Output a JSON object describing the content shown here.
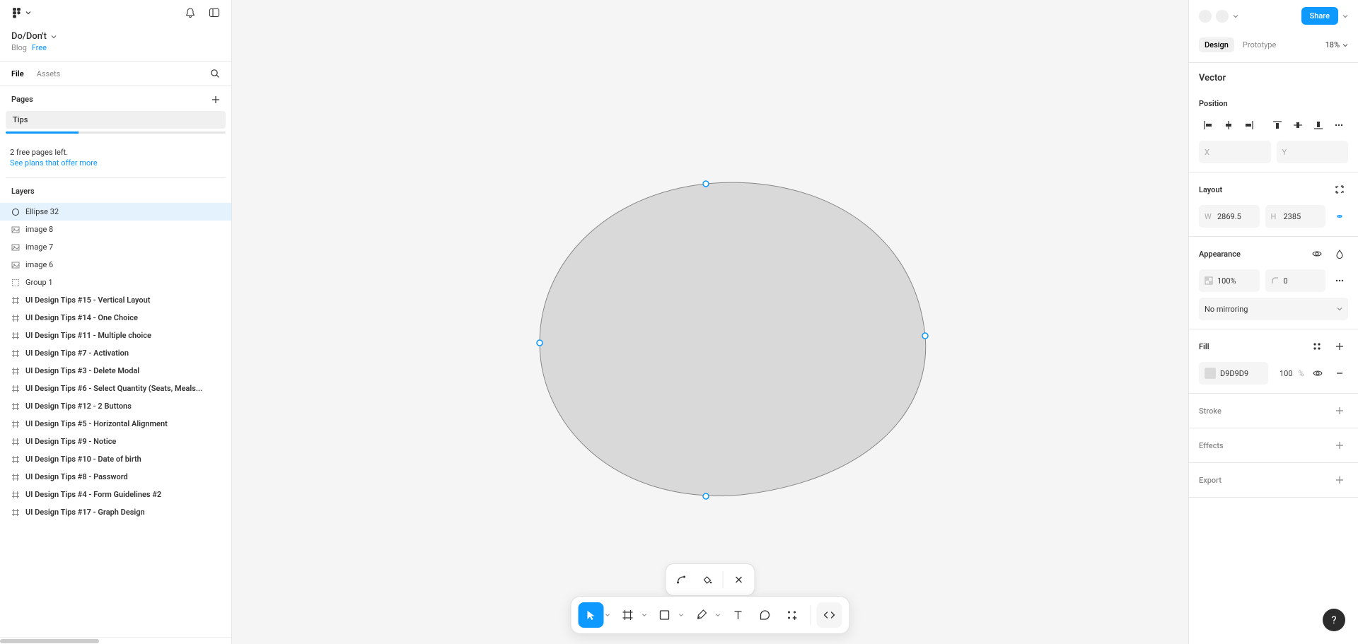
{
  "document": {
    "title": "Do/Don't"
  },
  "breadcrumb": {
    "parent": "Blog",
    "plan": "Free"
  },
  "leftTabs": {
    "file": "File",
    "assets": "Assets"
  },
  "pagesSection": {
    "title": "Pages"
  },
  "pages": [
    {
      "name": "Tips",
      "active": true
    }
  ],
  "upsell": {
    "line1": "2 free pages left.",
    "link": "See plans that offer more"
  },
  "layersSection": {
    "title": "Layers"
  },
  "layers": [
    {
      "name": "Ellipse 32",
      "icon": "ellipse",
      "selected": true
    },
    {
      "name": "image 8",
      "icon": "image"
    },
    {
      "name": "image 7",
      "icon": "image"
    },
    {
      "name": "image 6",
      "icon": "image"
    },
    {
      "name": "Group 1",
      "icon": "group"
    },
    {
      "name": "UI Design Tips #15 - Vertical Layout",
      "icon": "frame",
      "bold": true
    },
    {
      "name": "UI Design Tips #14 - One Choice",
      "icon": "frame",
      "bold": true
    },
    {
      "name": "UI Design Tips #11 - Multiple choice",
      "icon": "frame",
      "bold": true
    },
    {
      "name": "UI Design Tips #7 - Activation",
      "icon": "frame",
      "bold": true
    },
    {
      "name": "UI Design Tips #3 - Delete Modal",
      "icon": "frame",
      "bold": true
    },
    {
      "name": "UI Design Tips #6 - Select Quantity (Seats, Meals...",
      "icon": "frame",
      "bold": true
    },
    {
      "name": "UI Design Tips #12 - 2 Buttons",
      "icon": "frame",
      "bold": true
    },
    {
      "name": "UI Design Tips #5 - Horizontal Alignment",
      "icon": "frame",
      "bold": true
    },
    {
      "name": "UI Design Tips #9 - Notice",
      "icon": "frame",
      "bold": true
    },
    {
      "name": "UI Design Tips #10 - Date of birth",
      "icon": "frame",
      "bold": true
    },
    {
      "name": "UI Design Tips #8 - Password",
      "icon": "frame",
      "bold": true
    },
    {
      "name": "UI Design Tips #4 - Form Guidelines #2",
      "icon": "frame",
      "bold": true
    },
    {
      "name": "UI Design Tips #17 - Graph Design",
      "icon": "frame",
      "bold": true
    }
  ],
  "right": {
    "share": "Share",
    "tabs": {
      "design": "Design",
      "prototype": "Prototype"
    },
    "zoom": "18%",
    "headerTitle": "Vector",
    "position": {
      "title": "Position",
      "x": "X",
      "y": "Y"
    },
    "layout": {
      "title": "Layout",
      "wLabel": "W",
      "w": "2869.5",
      "hLabel": "H",
      "h": "2385"
    },
    "appearance": {
      "title": "Appearance",
      "opacity": "100%",
      "radius": "0",
      "mirroring": "No mirroring"
    },
    "fill": {
      "title": "Fill",
      "hex": "D9D9D9",
      "pct": "100",
      "pctUnit": "%"
    },
    "stroke": {
      "title": "Stroke"
    },
    "effects": {
      "title": "Effects"
    },
    "export": {
      "title": "Export"
    }
  },
  "help": "?"
}
